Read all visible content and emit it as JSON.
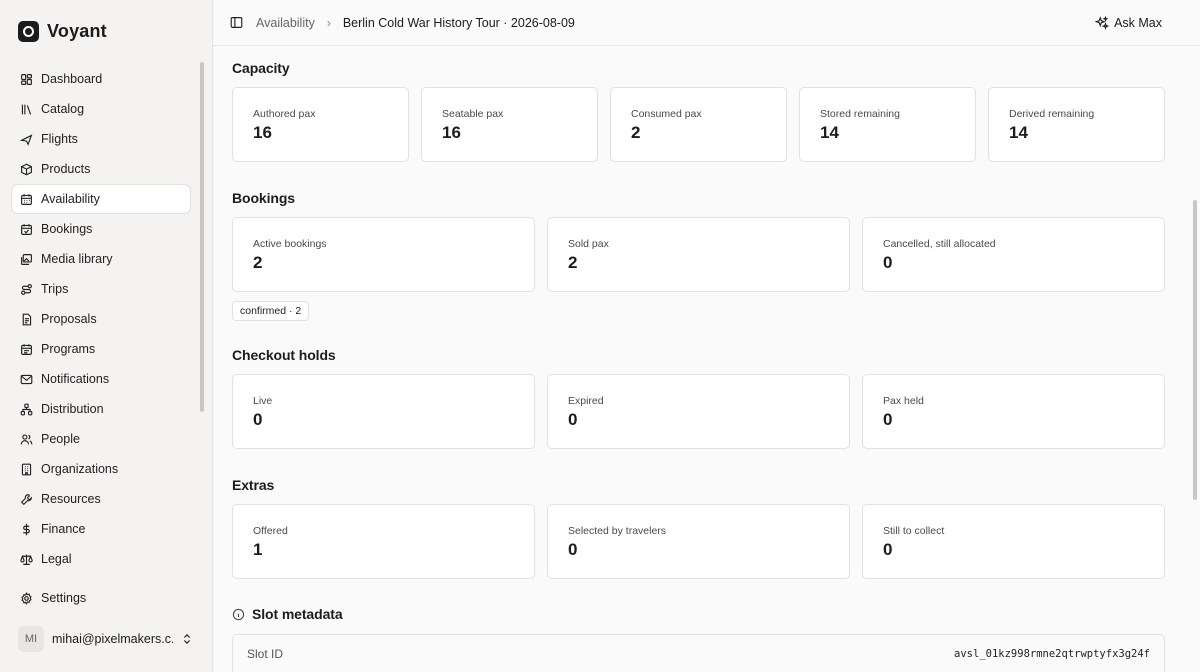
{
  "brand": {
    "name": "Voyant"
  },
  "sidebar": {
    "items": [
      {
        "label": "Dashboard",
        "icon": "dashboard-icon"
      },
      {
        "label": "Catalog",
        "icon": "catalog-icon"
      },
      {
        "label": "Flights",
        "icon": "plane-icon"
      },
      {
        "label": "Products",
        "icon": "package-icon"
      },
      {
        "label": "Availability",
        "icon": "calendar-icon",
        "active": true
      },
      {
        "label": "Bookings",
        "icon": "calendar-check-icon"
      },
      {
        "label": "Media library",
        "icon": "images-icon"
      },
      {
        "label": "Trips",
        "icon": "route-icon"
      },
      {
        "label": "Proposals",
        "icon": "document-icon"
      },
      {
        "label": "Programs",
        "icon": "calendar-range-icon"
      },
      {
        "label": "Notifications",
        "icon": "mail-icon"
      },
      {
        "label": "Distribution",
        "icon": "network-icon"
      },
      {
        "label": "People",
        "icon": "users-icon"
      },
      {
        "label": "Organizations",
        "icon": "building-icon"
      },
      {
        "label": "Resources",
        "icon": "wrench-icon"
      },
      {
        "label": "Finance",
        "icon": "dollar-icon"
      },
      {
        "label": "Legal",
        "icon": "scale-icon"
      }
    ],
    "settings": {
      "label": "Settings",
      "icon": "gear-icon"
    },
    "user": {
      "initials": "MI",
      "email": "mihai@pixelmakers.c..."
    }
  },
  "header": {
    "breadcrumb_parent": "Availability",
    "breadcrumb_current": "Berlin Cold War History Tour · 2026-08-09",
    "ask_label": "Ask Max"
  },
  "capacity": {
    "title": "Capacity",
    "cards": [
      {
        "label": "Authored pax",
        "value": "16"
      },
      {
        "label": "Seatable pax",
        "value": "16"
      },
      {
        "label": "Consumed pax",
        "value": "2"
      },
      {
        "label": "Stored remaining",
        "value": "14"
      },
      {
        "label": "Derived remaining",
        "value": "14"
      }
    ]
  },
  "bookings": {
    "title": "Bookings",
    "cards": [
      {
        "label": "Active bookings",
        "value": "2"
      },
      {
        "label": "Sold pax",
        "value": "2"
      },
      {
        "label": "Cancelled, still allocated",
        "value": "0"
      }
    ],
    "tag": "confirmed · 2"
  },
  "holds": {
    "title": "Checkout holds",
    "cards": [
      {
        "label": "Live",
        "value": "0"
      },
      {
        "label": "Expired",
        "value": "0"
      },
      {
        "label": "Pax held",
        "value": "0"
      }
    ]
  },
  "extras": {
    "title": "Extras",
    "cards": [
      {
        "label": "Offered",
        "value": "1"
      },
      {
        "label": "Selected by travelers",
        "value": "0"
      },
      {
        "label": "Still to collect",
        "value": "0"
      }
    ]
  },
  "metadata": {
    "title": "Slot metadata",
    "slot_id_label": "Slot ID",
    "slot_id_value": "avsl_01kz998rmne2qtrwptyfx3g24f"
  }
}
